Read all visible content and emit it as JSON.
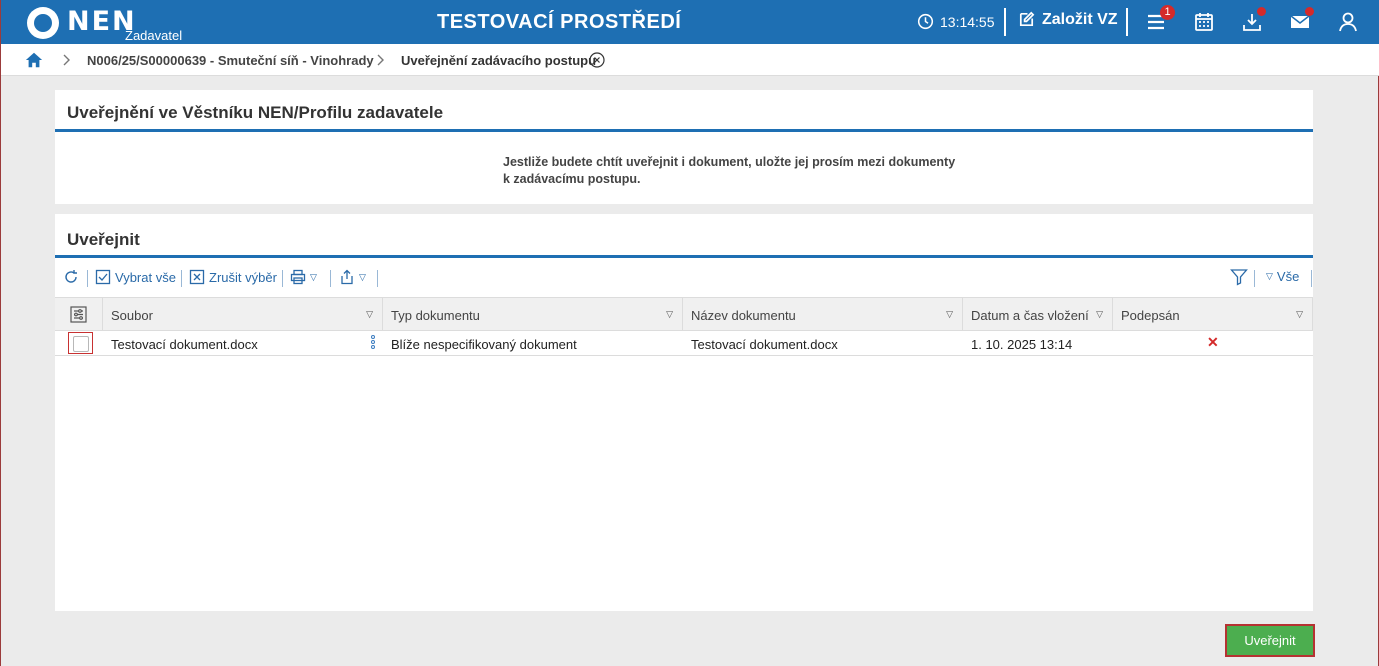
{
  "header": {
    "logo_text": "NEN",
    "logo_sub": "Zadavatel",
    "env_title": "TESTOVACÍ PROSTŘEDÍ",
    "time": "13:14:55",
    "create_label": "Založit VZ",
    "menu_badge": "1",
    "icons": [
      "clock-icon",
      "edit-icon",
      "menu-icon",
      "calendar-icon",
      "download-icon",
      "mail-icon",
      "user-icon"
    ]
  },
  "breadcrumb": {
    "items": [
      "N006/25/S00000639 - Smuteční síň - Vinohrady",
      "Uveřejnění zadávacího postupu"
    ]
  },
  "panel1": {
    "title": "Uveřejnění ve Věstníku NEN/Profilu zadavatele",
    "info_line1": "Jestliže budete chtít uveřejnit i dokument, uložte jej prosím mezi dokumenty",
    "info_line2": "k zadávacímu postupu."
  },
  "panel2": {
    "title": "Uveřejnit",
    "toolbar": {
      "select_all": "Vybrat vše",
      "cancel_selection": "Zrušit výběr",
      "filter_all": "Vše"
    },
    "columns": [
      "Soubor",
      "Typ dokumentu",
      "Název dokumentu",
      "Datum a čas vložení",
      "Podepsán"
    ],
    "rows": [
      {
        "file": "Testovací dokument.docx",
        "type": "Blíže nespecifikovaný dokument",
        "name": "Testovací dokument.docx",
        "date": "1. 10. 2025 13:14",
        "signed": "✕"
      }
    ]
  },
  "actions": {
    "publish": "Uveřejnit"
  },
  "colors": {
    "brand": "#1e6fb3",
    "publish": "#4cae4f",
    "alert": "#d42a2a"
  }
}
